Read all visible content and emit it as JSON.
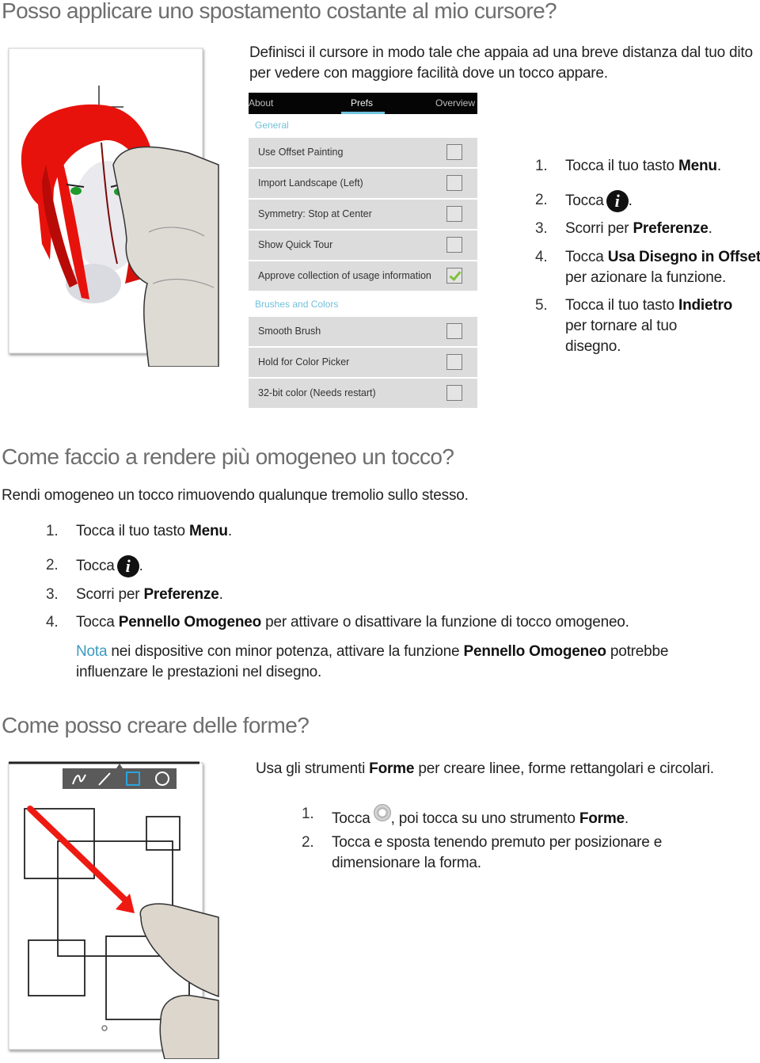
{
  "section1": {
    "title": "Posso applicare uno spostamento costante al mio cursore?",
    "intro": "Definisci il cursore in modo tale che appaia ad una breve distanza dal tuo dito per vedere con maggiore facilità dove un tocco appare.",
    "prefs_screen": {
      "tabs": [
        "About",
        "Prefs",
        "Overview"
      ],
      "active_tab": "Prefs",
      "sections": [
        {
          "header": "General",
          "items": [
            {
              "label": "Use Offset Painting",
              "checked": false
            },
            {
              "label": "Import Landscape (Left)",
              "checked": false
            },
            {
              "label": "Symmetry: Stop at Center",
              "checked": false
            },
            {
              "label": "Show Quick Tour",
              "checked": false
            },
            {
              "label": "Approve collection of usage information",
              "checked": true
            }
          ]
        },
        {
          "header": "Brushes and Colors",
          "items": [
            {
              "label": "Smooth Brush",
              "checked": false
            },
            {
              "label": "Hold for Color Picker",
              "checked": false
            },
            {
              "label": "32-bit color (Needs restart)",
              "checked": false
            }
          ]
        }
      ]
    },
    "steps": [
      {
        "num": "1.",
        "pre": "Tocca il tuo tasto ",
        "bold": "Menu",
        "post": "."
      },
      {
        "num": "2.",
        "pre": "Tocca",
        "icon": "info-icon",
        "post": "."
      },
      {
        "num": "3.",
        "pre": "Scorri per ",
        "bold": "Preferenze",
        "post": "."
      },
      {
        "num": "4.",
        "pre": "Tocca ",
        "bold": "Usa Disegno in Offset",
        "line2": "per azionare la funzione."
      },
      {
        "num": "5.",
        "pre": "Tocca il tuo tasto ",
        "bold": "Indietro",
        "line2": "per tornare al tuo",
        "line3": "disegno."
      }
    ]
  },
  "section2": {
    "title": "Come faccio a rendere più omogeneo un tocco?",
    "intro": "Rendi omogeneo un tocco rimuovendo qualunque tremolio sullo stesso.",
    "steps": [
      {
        "num": "1.",
        "pre": "Tocca il tuo tasto ",
        "bold": "Menu",
        "post": "."
      },
      {
        "num": "2.",
        "pre": "Tocca",
        "icon": "info-icon",
        "post": "."
      },
      {
        "num": "3.",
        "pre": "Scorri per ",
        "bold": "Preferenze",
        "post": "."
      },
      {
        "num": "4.",
        "pre": "Tocca ",
        "bold": "Pennello Omogeneo",
        "post": " per attivare o disattivare la funzione di tocco omogeneo."
      }
    ],
    "note": {
      "label": "Nota",
      "pre": " nei dispositive con minor potenza, attivare la funzione ",
      "bold": "Pennello Omogeneo",
      "post": " potrebbe",
      "line2": "influenzare le prestazioni nel disegno."
    }
  },
  "section3": {
    "title": "Come posso creare delle forme?",
    "intro_pre": "Usa gli strumenti ",
    "intro_bold": "Forme",
    "intro_post": " per creare linee, forme rettangolari e circolari.",
    "toolbar_tools": [
      "freehand",
      "line",
      "rectangle",
      "circle"
    ],
    "active_tool": "rectangle",
    "steps": [
      {
        "num": "1.",
        "pre": "Tocca",
        "icon": "brush-ring-icon",
        "post": ", poi tocca su uno strumento ",
        "bold": "Forme",
        "post2": "."
      },
      {
        "num": "2.",
        "pre": "Tocca e sposta tenendo premuto per posizionare e",
        "line2": "dimensionare la forma."
      }
    ]
  },
  "colors": {
    "heading": "#6e6e6e",
    "accent": "#3a9bbd",
    "tab_underline": "#6fc3df",
    "hair_red": "#e8120c",
    "arrow_red": "#ee1a12",
    "tool_active": "#2aa4dc"
  }
}
